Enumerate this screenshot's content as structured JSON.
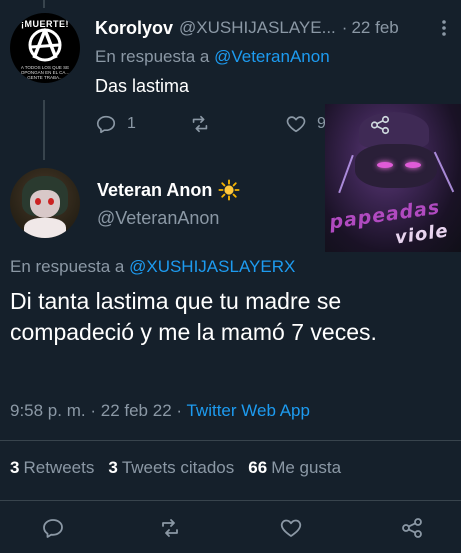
{
  "reply_tweet": {
    "author_name": "Korolyov",
    "author_handle": "@XUSHIJASLAYE...",
    "separator": "·",
    "date": "22 feb",
    "in_reply_prefix": "En respuesta a",
    "in_reply_handle": "@VeteranAnon",
    "text": "Das lastima",
    "reply_count": "1",
    "like_count": "9",
    "avatar_top_text": "¡MUERTE!",
    "avatar_bottom_text": "A TODOS LOS QUE SE OPONGAN EN EL CA... GENTE TRABA...",
    "sticker_text_line1": "papeadas",
    "sticker_text_line2": "viole"
  },
  "main_tweet": {
    "author_name": "Veteran Anon",
    "author_handle": "@VeteranAnon",
    "in_reply_prefix": "En respuesta a",
    "in_reply_handle": "@XUSHIJASLAYERX",
    "text": "Di tanta lastima que tu madre se compadeció y me la mamó 7 veces.",
    "time": "9:58 p. m.",
    "date": "22 feb 22",
    "separator": "·",
    "source": "Twitter Web App"
  },
  "stats": {
    "retweets_count": "3",
    "retweets_label": "Retweets",
    "quotes_count": "3",
    "quotes_label": "Tweets citados",
    "likes_count": "66",
    "likes_label": "Me gusta"
  },
  "icons": {
    "reply": "reply-icon",
    "retweet": "retweet-icon",
    "like": "heart-icon",
    "share": "share-icon",
    "more": "more-vertical-icon",
    "badge": "sun-icon"
  },
  "colors": {
    "background": "#15202b",
    "text_primary": "#ffffff",
    "text_secondary": "#8b98a5",
    "accent": "#1d9bf0",
    "divider": "#38444d"
  }
}
